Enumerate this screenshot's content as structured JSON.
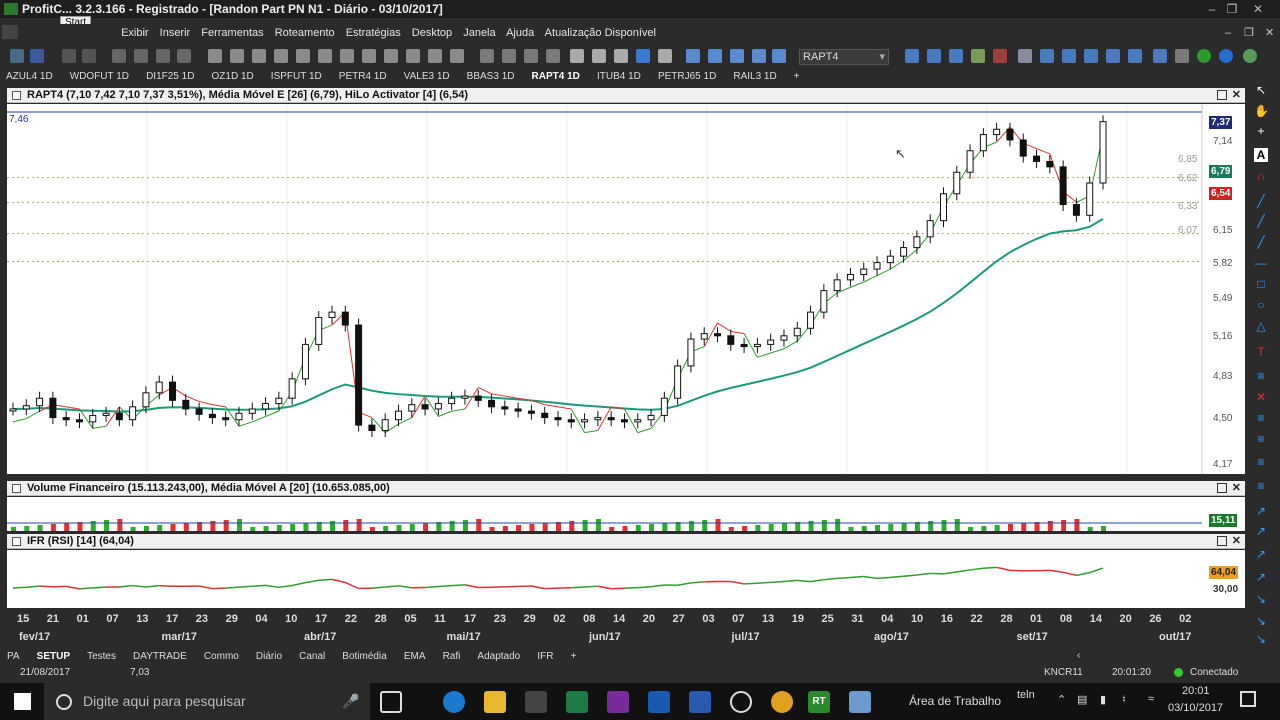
{
  "window": {
    "title": "ProfitC... 3.2.3.166 - Registrado - [Randon Part PN N1 - Diário - 03/10/2017]",
    "start_label": "Start"
  },
  "menu": [
    "Exibir",
    "Inserir",
    "Ferramentas",
    "Roteamento",
    "Estratégias",
    "Desktop",
    "Janela",
    "Ajuda",
    "Atualização Disponível"
  ],
  "toolbar": {
    "asset": "RAPT4"
  },
  "asset_tabs": [
    "AZUL4 1D",
    "WDOFUT 1D",
    "DI1F25 1D",
    "OZ1D 1D",
    "ISPFUT 1D",
    "PETR4 1D",
    "VALE3 1D",
    "BBAS3 1D",
    "RAPT4 1D",
    "ITUB4 1D",
    "PETRJ65 1D",
    "RAIL3 1D"
  ],
  "active_tab": "RAPT4 1D",
  "price_pane": {
    "header": "RAPT4 (7,10  7,42  7,10  7,37  3,51%), Média Móvel E [26] (6,79), HiLo Activator [4] (6,54)",
    "top_left_value": "7,46",
    "y_labels": [
      "7,14",
      "6,85",
      "6,62",
      "6,33",
      "6,15",
      "6,07",
      "5,82",
      "5,49",
      "5,16",
      "4,83",
      "4,50",
      "4,17"
    ],
    "badges": [
      {
        "text": "7,37",
        "color": "#1f2a7a"
      },
      {
        "text": "6,79",
        "color": "#1a7a5c"
      },
      {
        "text": "6,54",
        "color": "#d32020"
      }
    ]
  },
  "volume_pane": {
    "header": "Volume Financeiro (15.113.243,00), Média Móvel A [20] (10.653.085,00)",
    "badge": "15,11"
  },
  "rsi_pane": {
    "header": "IFR (RSI) [14] (64,04)",
    "badge": "64,04",
    "y_label": "30,00"
  },
  "dates": [
    "15",
    "21",
    "01",
    "07",
    "13",
    "17",
    "23",
    "29",
    "04",
    "10",
    "17",
    "22",
    "28",
    "05",
    "11",
    "17",
    "23",
    "29",
    "02",
    "08",
    "14",
    "20",
    "27",
    "03",
    "07",
    "13",
    "19",
    "25",
    "31",
    "04",
    "10",
    "16",
    "22",
    "28",
    "01",
    "08",
    "14",
    "20",
    "26",
    "02"
  ],
  "months": [
    "fev/17",
    "mar/17",
    "abr/17",
    "mai/17",
    "jun/17",
    "jul/17",
    "ago/17",
    "set/17",
    "out/17"
  ],
  "sheet_tabs": [
    "PA",
    "SETUP",
    "Testes",
    "DAYTRADE",
    "Commo",
    "Diário",
    "Canal",
    "Botimédia",
    "EMA",
    "Rafi",
    "Adaptado",
    "IFR"
  ],
  "active_sheet": "SETUP",
  "status": {
    "date": "21/08/2017",
    "value": "7,03",
    "symbol": "KNCR11",
    "time": "20:01:20",
    "connection": "Conectado"
  },
  "taskbar": {
    "search_placeholder": "Digite aqui para pesquisar",
    "desktop_label": "Área de Trabalho",
    "tray_app": "teln",
    "clock_time": "20:01",
    "clock_date": "03/10/2017"
  },
  "colors": {
    "candle": "#111111",
    "hilo_up": "#2e9e2e",
    "hilo_down": "#e03030",
    "ema": "#1a9a7a",
    "volume_up": "#2eaa2e",
    "volume_down": "#e03030",
    "rsi_up": "#2e9e2e",
    "rsi_down": "#e03030",
    "accent": "#3399ff"
  },
  "chart_data": {
    "type": "candlestick",
    "symbol": "RAPT4",
    "close_series": [
      4.7,
      4.73,
      4.8,
      4.62,
      4.6,
      4.58,
      4.64,
      4.66,
      4.6,
      4.72,
      4.85,
      4.95,
      4.78,
      4.7,
      4.65,
      4.62,
      4.6,
      4.66,
      4.7,
      4.75,
      4.8,
      4.98,
      5.3,
      5.55,
      5.6,
      5.48,
      4.55,
      4.5,
      4.6,
      4.68,
      4.74,
      4.7,
      4.75,
      4.8,
      4.82,
      4.78,
      4.72,
      4.7,
      4.68,
      4.66,
      4.62,
      4.6,
      4.58,
      4.6,
      4.62,
      4.6,
      4.58,
      4.6,
      4.64,
      4.8,
      5.1,
      5.35,
      5.4,
      5.38,
      5.3,
      5.28,
      5.3,
      5.34,
      5.38,
      5.45,
      5.6,
      5.8,
      5.9,
      5.95,
      6.0,
      6.06,
      6.12,
      6.2,
      6.3,
      6.45,
      6.7,
      6.9,
      7.1,
      7.25,
      7.3,
      7.2,
      7.05,
      7.0,
      6.95,
      6.6,
      6.5,
      6.8,
      7.37
    ],
    "ema26_last": 6.79,
    "hilo_last": 6.54,
    "ylim": [
      4.17,
      7.46
    ],
    "volume_last": 15.11,
    "rsi_last": 64.04
  }
}
